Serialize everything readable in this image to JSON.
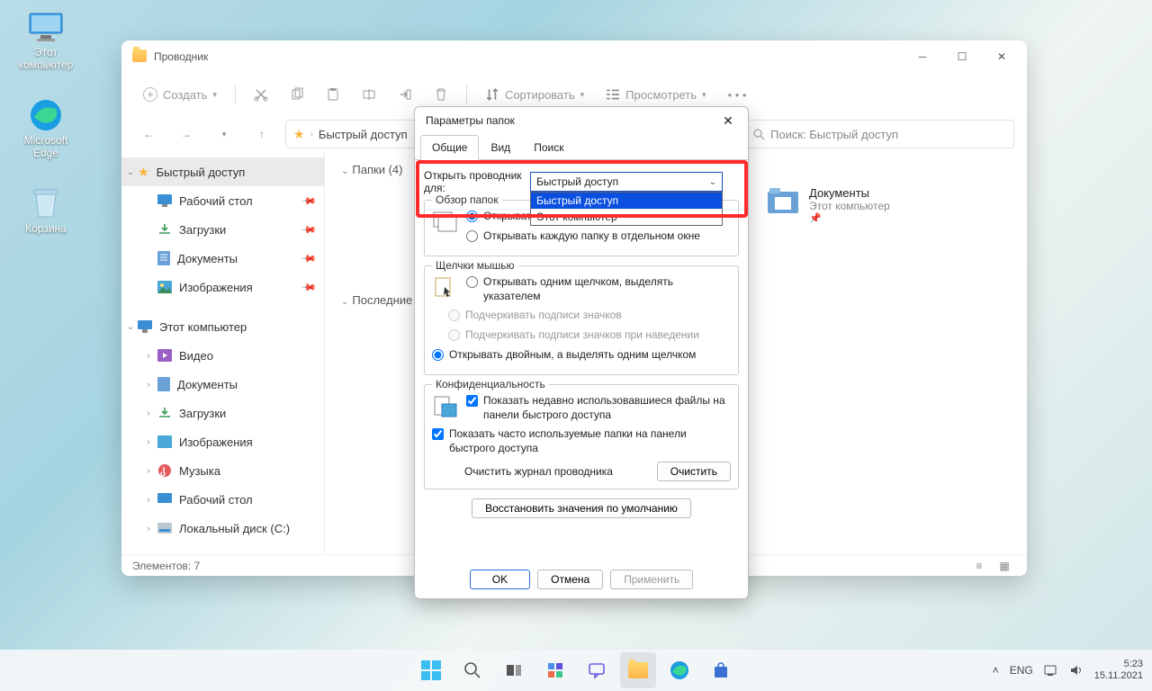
{
  "desktop": {
    "this_pc": "Этот компьютер",
    "edge": "Microsoft Edge",
    "recycle": "Корзина"
  },
  "explorer": {
    "title": "Проводник",
    "toolbar": {
      "create": "Создать",
      "sort": "Сортировать",
      "view": "Просмотреть"
    },
    "breadcrumb": "Быстрый доступ",
    "search_placeholder": "Поиск: Быстрый доступ",
    "sidebar": {
      "quick": "Быстрый доступ",
      "desktop": "Рабочий стол",
      "downloads": "Загрузки",
      "documents": "Документы",
      "pictures": "Изображения",
      "this_pc": "Этот компьютер",
      "videos": "Видео",
      "documents2": "Документы",
      "downloads2": "Загрузки",
      "pictures2": "Изображения",
      "music": "Музыка",
      "desktop2": "Рабочий стол",
      "localdisk": "Локальный диск (C:)"
    },
    "content": {
      "folders_header": "Папки (4)",
      "recent_header": "Последние",
      "documents": {
        "name": "Документы",
        "sub": "Этот компьютер"
      }
    },
    "status": "Элементов: 7"
  },
  "dlg": {
    "title": "Параметры папок",
    "tabs": {
      "general": "Общие",
      "view": "Вид",
      "search": "Поиск"
    },
    "open_for_label": "Открыть проводник для:",
    "combo_selected": "Быстрый доступ",
    "combo_options": {
      "quick": "Быстрый доступ",
      "this_pc": "Этот компьютер"
    },
    "browse_group": "Обзор папок",
    "browse_same": "Открывать папки в одном и том же окне",
    "browse_new": "Открывать каждую папку в отдельном окне",
    "click_group": "Щелчки мышью",
    "click_single": "Открывать одним щелчком, выделять указателем",
    "underline_always": "Подчеркивать подписи значков",
    "underline_hover": "Подчеркивать подписи значков при наведении",
    "click_double": "Открывать двойным, а выделять одним щелчком",
    "privacy_group": "Конфиденциальность",
    "privacy_files": "Показать недавно использовавшиеся файлы на панели быстрого доступа",
    "privacy_folders": "Показать часто используемые папки на панели быстрого доступа",
    "clear_label": "Очистить журнал проводника",
    "clear_btn": "Очистить",
    "restore": "Восстановить значения по умолчанию",
    "ok": "OK",
    "cancel": "Отмена",
    "apply": "Применить"
  },
  "tray": {
    "lang": "ENG",
    "time": "5:23",
    "date": "15.11.2021"
  }
}
